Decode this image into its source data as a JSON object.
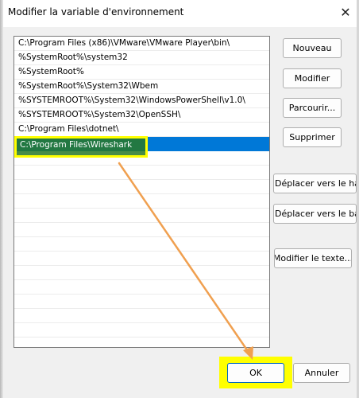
{
  "window": {
    "title": "Modifier la variable d'environnement",
    "close_glyph": "✕"
  },
  "path_list": {
    "entries": [
      "C:\\Program Files (x86)\\VMware\\VMware Player\\bin\\",
      "%SystemRoot%\\system32",
      "%SystemRoot%",
      "%SystemRoot%\\System32\\Wbem",
      "%SYSTEMROOT%\\System32\\WindowsPowerShell\\v1.0\\",
      "%SYSTEMROOT%\\System32\\OpenSSH\\",
      "C:\\Program Files\\dotnet\\",
      "C:\\Program Files\\Wireshark"
    ],
    "selected_index": 7
  },
  "buttons": {
    "new": "Nouveau",
    "edit": "Modifier",
    "browse": "Parcourir...",
    "delete": "Supprimer",
    "move_up": "Déplacer vers le haut",
    "move_down": "Déplacer vers le bas",
    "edit_text": "Modifier le texte...",
    "ok": "OK",
    "cancel": "Annuler"
  },
  "colors": {
    "selection": "#0078d7",
    "highlight_yellow": "#ffff00",
    "arrow_orange": "#f0a050"
  },
  "icons": {
    "close": "close-icon",
    "annotation_arrow": "arrow-annotation"
  }
}
